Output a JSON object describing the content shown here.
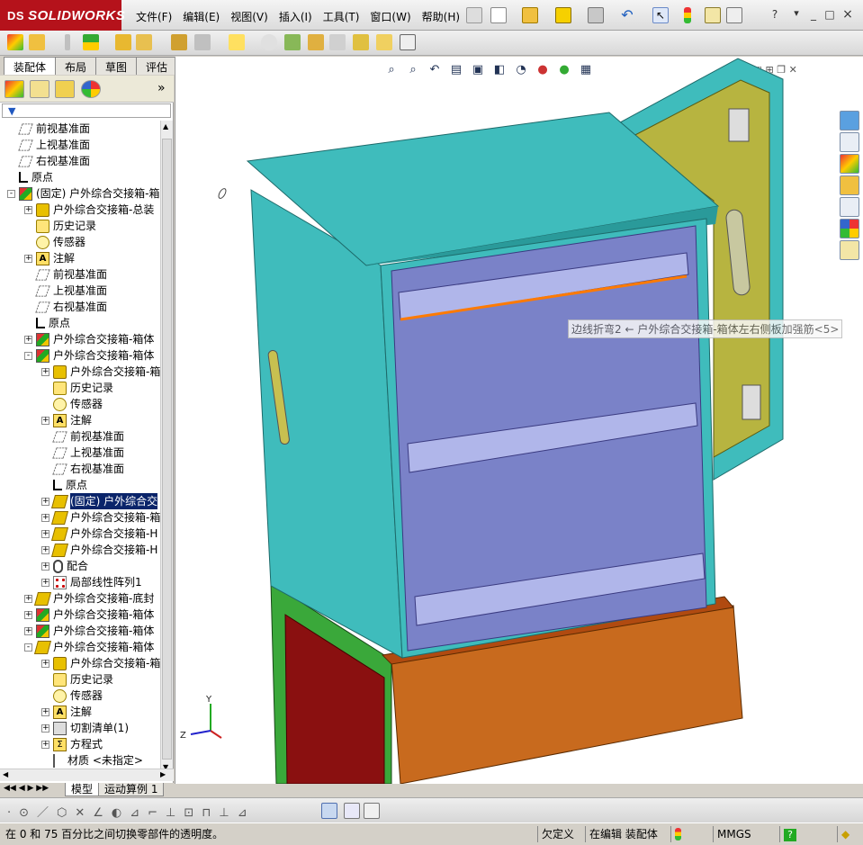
{
  "app": {
    "logo_brand": "SOLIDWORKS",
    "logo_prefix": "DS"
  },
  "menu": [
    {
      "label": "文件(F)"
    },
    {
      "label": "编辑(E)"
    },
    {
      "label": "视图(V)"
    },
    {
      "label": "插入(I)"
    },
    {
      "label": "工具(T)"
    },
    {
      "label": "窗口(W)"
    },
    {
      "label": "帮助(H)"
    }
  ],
  "window_controls": {
    "help": "?",
    "minimize": "_",
    "restore": "□",
    "close": "×"
  },
  "command_tabs": [
    {
      "label": "装配体"
    },
    {
      "label": "布局"
    },
    {
      "label": "草图"
    },
    {
      "label": "评估"
    }
  ],
  "panel": {
    "expand_label": "»"
  },
  "tree": [
    {
      "label": "前视基准面",
      "indent": 0,
      "icon": "plane",
      "exp": ""
    },
    {
      "label": "上视基准面",
      "indent": 0,
      "icon": "plane",
      "exp": ""
    },
    {
      "label": "右视基准面",
      "indent": 0,
      "icon": "plane",
      "exp": ""
    },
    {
      "label": "原点",
      "indent": 0,
      "icon": "origin",
      "exp": ""
    },
    {
      "label": "(固定) 户外综合交接箱-箱",
      "indent": 0,
      "icon": "asm",
      "exp": "-"
    },
    {
      "label": "户外综合交接箱-总装",
      "indent": 1,
      "icon": "part",
      "exp": "+"
    },
    {
      "label": "历史记录",
      "indent": 1,
      "icon": "hist",
      "exp": ""
    },
    {
      "label": "传感器",
      "indent": 1,
      "icon": "sensor",
      "exp": ""
    },
    {
      "label": "注解",
      "indent": 1,
      "icon": "note",
      "exp": "+"
    },
    {
      "label": "前视基准面",
      "indent": 1,
      "icon": "plane",
      "exp": ""
    },
    {
      "label": "上视基准面",
      "indent": 1,
      "icon": "plane",
      "exp": ""
    },
    {
      "label": "右视基准面",
      "indent": 1,
      "icon": "plane",
      "exp": ""
    },
    {
      "label": "原点",
      "indent": 1,
      "icon": "origin",
      "exp": ""
    },
    {
      "label": "户外综合交接箱-箱体",
      "indent": 1,
      "icon": "asm",
      "exp": "+"
    },
    {
      "label": "户外综合交接箱-箱体",
      "indent": 1,
      "icon": "asm",
      "exp": "-"
    },
    {
      "label": "户外综合交接箱-箱",
      "indent": 2,
      "icon": "part",
      "exp": "+"
    },
    {
      "label": "历史记录",
      "indent": 2,
      "icon": "hist",
      "exp": ""
    },
    {
      "label": "传感器",
      "indent": 2,
      "icon": "sensor",
      "exp": ""
    },
    {
      "label": "注解",
      "indent": 2,
      "icon": "note",
      "exp": "+"
    },
    {
      "label": "前视基准面",
      "indent": 2,
      "icon": "plane",
      "exp": ""
    },
    {
      "label": "上视基准面",
      "indent": 2,
      "icon": "plane",
      "exp": ""
    },
    {
      "label": "右视基准面",
      "indent": 2,
      "icon": "plane",
      "exp": ""
    },
    {
      "label": "原点",
      "indent": 2,
      "icon": "origin",
      "exp": ""
    },
    {
      "label": "(固定) 户外综合交",
      "indent": 2,
      "icon": "sheet",
      "exp": "+",
      "selected": true
    },
    {
      "label": "户外综合交接箱-箱",
      "indent": 2,
      "icon": "sheet",
      "exp": "+"
    },
    {
      "label": "户外综合交接箱-H",
      "indent": 2,
      "icon": "sheet",
      "exp": "+"
    },
    {
      "label": "户外综合交接箱-H",
      "indent": 2,
      "icon": "sheet",
      "exp": "+"
    },
    {
      "label": "配合",
      "indent": 2,
      "icon": "mate",
      "exp": "+"
    },
    {
      "label": "局部线性阵列1",
      "indent": 2,
      "icon": "pattern",
      "exp": "+"
    },
    {
      "label": "户外综合交接箱-底封",
      "indent": 1,
      "icon": "sheet",
      "exp": "+"
    },
    {
      "label": "户外综合交接箱-箱体",
      "indent": 1,
      "icon": "asm",
      "exp": "+"
    },
    {
      "label": "户外综合交接箱-箱体",
      "indent": 1,
      "icon": "asm",
      "exp": "+"
    },
    {
      "label": "户外综合交接箱-箱体",
      "indent": 1,
      "icon": "sheet",
      "exp": "-"
    },
    {
      "label": "户外综合交接箱-箱",
      "indent": 2,
      "icon": "part",
      "exp": "+"
    },
    {
      "label": "历史记录",
      "indent": 2,
      "icon": "hist",
      "exp": ""
    },
    {
      "label": "传感器",
      "indent": 2,
      "icon": "sensor",
      "exp": ""
    },
    {
      "label": "注解",
      "indent": 2,
      "icon": "note",
      "exp": "+"
    },
    {
      "label": "切割清单(1)",
      "indent": 2,
      "icon": "cut",
      "exp": "+"
    },
    {
      "label": "方程式",
      "indent": 2,
      "icon": "eq",
      "exp": "+"
    },
    {
      "label": "材质 <未指定>",
      "indent": 2,
      "icon": "mat",
      "exp": ""
    }
  ],
  "model_tabs": [
    {
      "label": "模型"
    },
    {
      "label": "运动算例 1"
    }
  ],
  "tooltip": "边线折弯2 ← 户外综合交接箱-箱体左右侧板加强筋<5>",
  "triad": {
    "x": "Z",
    "y": "Y"
  },
  "status": {
    "message": "在 0 和 75 百分比之间切换零部件的透明度。",
    "definition": "欠定义",
    "editing": "在编辑 装配体",
    "units": "MMGS",
    "help": "?"
  },
  "colors": {
    "cabinet_cyan": "#3fbcbc",
    "door_olive": "#b7b440",
    "interior_blue": "#7a82c8",
    "base_orange": "#c86a1e",
    "base_green": "#3aa83a",
    "base_red": "#8a1010",
    "highlight_orange": "#ff7a00"
  }
}
